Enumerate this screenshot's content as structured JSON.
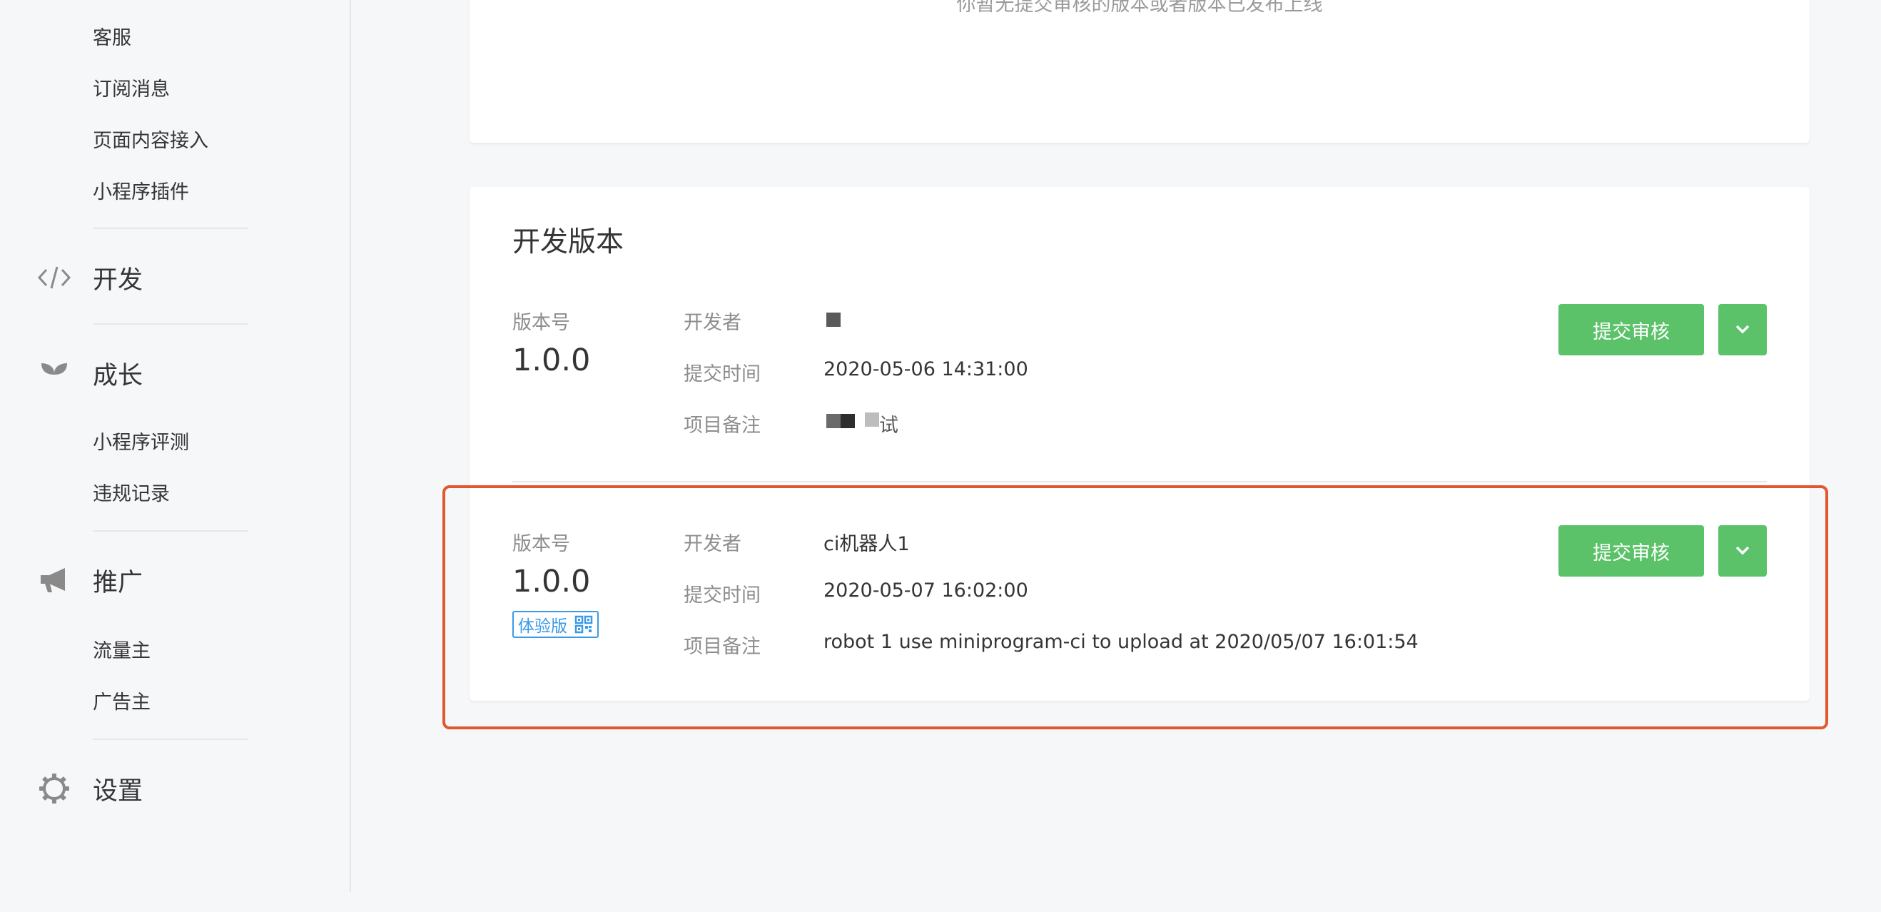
{
  "sidebar": {
    "sub_items_top": [
      "客服",
      "订阅消息",
      "页面内容接入",
      "小程序插件"
    ],
    "groups": [
      {
        "label": "开发",
        "icon": "code-icon"
      },
      {
        "label": "成长",
        "icon": "sprout-icon",
        "items": [
          "小程序评测",
          "违规记录"
        ]
      },
      {
        "label": "推广",
        "icon": "megaphone-icon",
        "items": [
          "流量主",
          "广告主"
        ]
      },
      {
        "label": "设置",
        "icon": "gear-icon"
      }
    ]
  },
  "top_panel": {
    "notice": "你暂无提交审核的版本或者版本已发布上线"
  },
  "dev_panel": {
    "title": "开发版本",
    "labels": {
      "version": "版本号",
      "developer": "开发者",
      "submit_time": "提交时间",
      "remark": "项目备注"
    },
    "versions": [
      {
        "version": "1.0.0",
        "developer": "",
        "submit_time": "2020-05-06 14:31:00",
        "remark": "试",
        "submit_button": "提交审核",
        "dropdown_icon": "chevron-down-icon"
      },
      {
        "version": "1.0.0",
        "badge": "体验版",
        "badge_icon": "qrcode-icon",
        "developer": "ci机器人1",
        "submit_time": "2020-05-07 16:02:00",
        "remark": "robot 1 use miniprogram-ci to upload at 2020/05/07 16:01:54",
        "submit_button": "提交审核",
        "dropdown_icon": "chevron-down-icon"
      }
    ]
  },
  "colors": {
    "accent_green": "#5bc26a",
    "badge_blue": "#3a9ae8",
    "highlight_red": "#e4572e"
  }
}
